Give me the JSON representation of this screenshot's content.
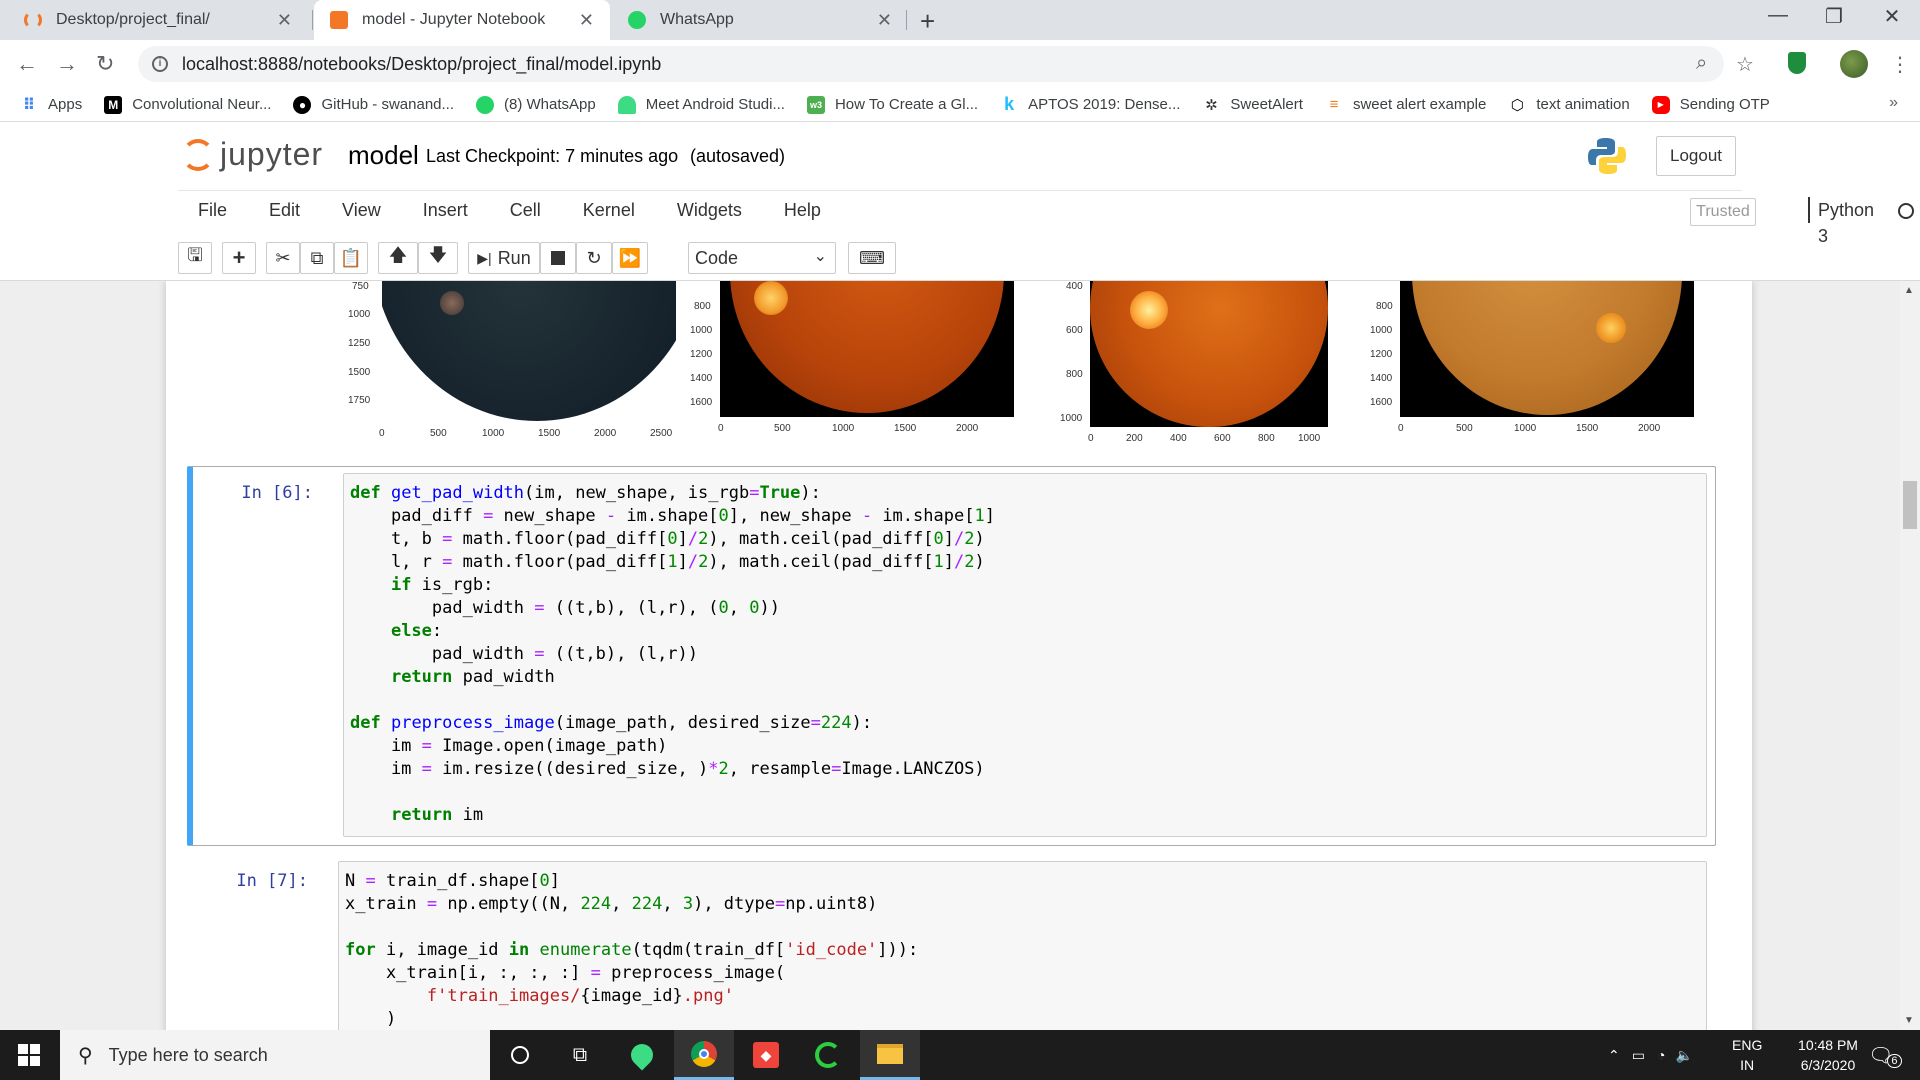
{
  "browser": {
    "tabs": [
      {
        "title": "Desktop/project_final/",
        "active": false
      },
      {
        "title": "model - Jupyter Notebook",
        "active": true
      },
      {
        "title": "WhatsApp",
        "active": false
      }
    ],
    "url": "localhost:8888/notebooks/Desktop/project_final/model.ipynb",
    "bookmarks": [
      "Apps",
      "Convolutional Neur...",
      "GitHub - swanand...",
      "(8) WhatsApp",
      "Meet Android Studi...",
      "How To Create a Gl...",
      "APTOS 2019: Dense...",
      "SweetAlert",
      "sweet alert example",
      "text animation",
      "Sending OTP"
    ]
  },
  "jupyter": {
    "logo_text": "jupyter",
    "notebook_name": "model",
    "checkpoint": "Last Checkpoint: 7 minutes ago",
    "autosave": "(autosaved)",
    "logout": "Logout",
    "menu": [
      "File",
      "Edit",
      "View",
      "Insert",
      "Cell",
      "Kernel",
      "Widgets",
      "Help"
    ],
    "trusted": "Trusted",
    "kernel": "Python 3",
    "run_label": "Run",
    "cell_type": "Code"
  },
  "output_plots": [
    {
      "x_ticks": [
        "0",
        "500",
        "1000",
        "1500",
        "2000",
        "2500"
      ],
      "y_ticks": [
        "750",
        "1000",
        "1250",
        "1500",
        "1750"
      ]
    },
    {
      "x_ticks": [
        "0",
        "500",
        "1000",
        "1500",
        "2000"
      ],
      "y_ticks": [
        "800",
        "1000",
        "1200",
        "1400",
        "1600"
      ]
    },
    {
      "x_ticks": [
        "0",
        "200",
        "400",
        "600",
        "800",
        "1000"
      ],
      "y_ticks": [
        "400",
        "600",
        "800",
        "1000"
      ]
    },
    {
      "x_ticks": [
        "0",
        "500",
        "1000",
        "1500",
        "2000"
      ],
      "y_ticks": [
        "800",
        "1000",
        "1200",
        "1400",
        "1600"
      ]
    }
  ],
  "cells": [
    {
      "prompt": "In [6]:"
    },
    {
      "prompt": "In [7]:"
    }
  ],
  "taskbar": {
    "search_placeholder": "Type here to search",
    "lang": "ENG",
    "region": "IN",
    "time": "10:48 PM",
    "date": "6/3/2020",
    "notifications": "6"
  }
}
